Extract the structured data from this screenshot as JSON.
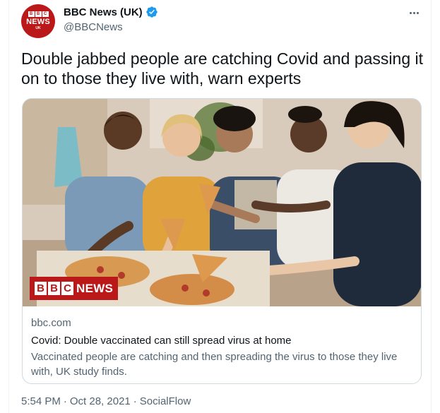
{
  "author": {
    "display_name": "BBC News (UK)",
    "handle": "@BBCNews",
    "avatar_blocks": [
      "B",
      "B",
      "C"
    ],
    "avatar_word": "NEWS",
    "avatar_region": "UK",
    "verified": true
  },
  "tweet": {
    "text": "Double jabbed people are catching Covid and passing it on to those they live with, warn experts"
  },
  "card": {
    "logo_blocks": [
      "B",
      "B",
      "C"
    ],
    "logo_word": "NEWS",
    "domain": "bbc.com",
    "title": "Covid: Double vaccinated can still spread virus at home",
    "description": "Vaccinated people are catching and then spreading the virus to those they live with, UK study finds."
  },
  "meta": {
    "time": "5:54 PM",
    "separator": "·",
    "date": "Oct 28, 2021",
    "source": "SocialFlow"
  },
  "colors": {
    "brand_red": "#bb1919",
    "verified_blue": "#1d9bf0",
    "secondary_text": "#536471"
  }
}
